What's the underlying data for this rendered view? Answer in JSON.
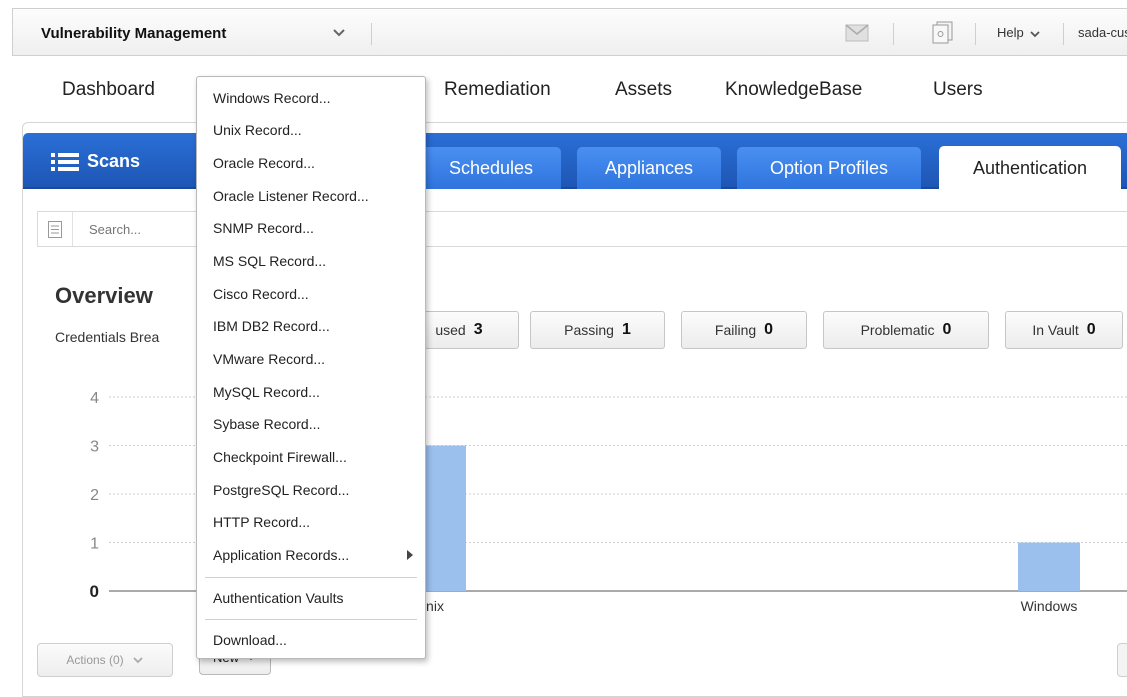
{
  "app": {
    "title": "Vulnerability Management",
    "help_label": "Help",
    "user_label": "sada-cus"
  },
  "nav": {
    "items": [
      "Dashboard",
      "Remediation",
      "Assets",
      "KnowledgeBase",
      "Users"
    ]
  },
  "tabs": {
    "section_label": "Scans",
    "items": [
      "Schedules",
      "Appliances",
      "Option Profiles",
      "Authentication"
    ],
    "active": "Authentication"
  },
  "search": {
    "placeholder": "Search..."
  },
  "overview": {
    "title": "Overview",
    "subtitle": "Credentials Brea"
  },
  "stats": [
    {
      "label": "used",
      "count": "3"
    },
    {
      "label": "Passing",
      "count": "1"
    },
    {
      "label": "Failing",
      "count": "0"
    },
    {
      "label": "Problematic",
      "count": "0"
    },
    {
      "label": "In Vault",
      "count": "0"
    }
  ],
  "chart_data": {
    "type": "bar",
    "categories": [
      "Unix",
      "Windows"
    ],
    "visible_category_labels": [
      "nix",
      "Windows"
    ],
    "values": [
      3,
      1
    ],
    "y_ticks": [
      "0",
      "1",
      "2",
      "3",
      "4"
    ],
    "ylim": [
      0,
      4
    ],
    "grid": true,
    "bar_color": "#9cc0ee"
  },
  "footer": {
    "actions_label": "Actions (0)",
    "new_label": "New"
  },
  "dropdown": {
    "items": [
      "Windows Record...",
      "Unix Record...",
      "Oracle Record...",
      "Oracle Listener Record...",
      "SNMP Record...",
      "MS SQL Record...",
      "Cisco Record...",
      "IBM DB2 Record...",
      "VMware Record...",
      "MySQL Record...",
      "Sybase Record...",
      "Checkpoint Firewall...",
      "PostgreSQL Record...",
      "HTTP Record...",
      "Application Records..."
    ],
    "vaults_label": "Authentication Vaults",
    "download_label": "Download..."
  },
  "colors": {
    "tabbar": "#1e56b5",
    "tab": "#2f74de",
    "bar": "#9cc0ee"
  },
  "icons": [
    "chevron-down-icon",
    "mail-icon",
    "files-icon",
    "list-icon",
    "menu-lines-icon",
    "submenu-arrow-icon"
  ]
}
